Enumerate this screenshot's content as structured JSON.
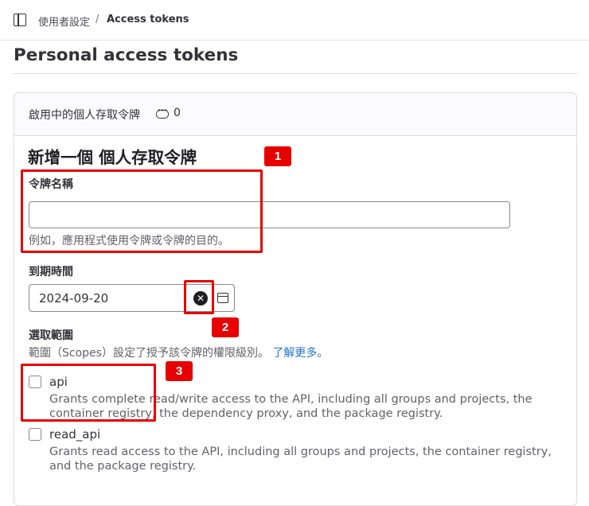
{
  "breadcrumb": {
    "parent": "使用者設定",
    "separator": "/",
    "current": "Access tokens"
  },
  "page": {
    "title": "Personal access tokens"
  },
  "active_tokens": {
    "label": "啟用中的個人存取令牌",
    "count": "0"
  },
  "form": {
    "title": "新增一個 個人存取令牌",
    "name_label": "令牌名稱",
    "name_value": "",
    "name_help": "例如，應用程式使用令牌或令牌的目的。",
    "expiry_label": "到期時間",
    "expiry_value": "2024-09-20",
    "scopes_label": "選取範圍",
    "scopes_help": "範圍（Scopes）設定了授予該令牌的權限級別。",
    "scopes_link": "了解更多。"
  },
  "scopes": [
    {
      "name": "api",
      "description": "Grants complete read/write access to the API, including all groups and projects, the container registry, the dependency proxy, and the package registry.",
      "checked": false
    },
    {
      "name": "read_api",
      "description": "Grants read access to the API, including all groups and projects, the container registry, and the package registry.",
      "checked": false
    }
  ],
  "annotations": [
    "1",
    "2",
    "3"
  ],
  "colors": {
    "annotation": "#e60000",
    "link": "#1f75cb",
    "text": "#333238"
  }
}
